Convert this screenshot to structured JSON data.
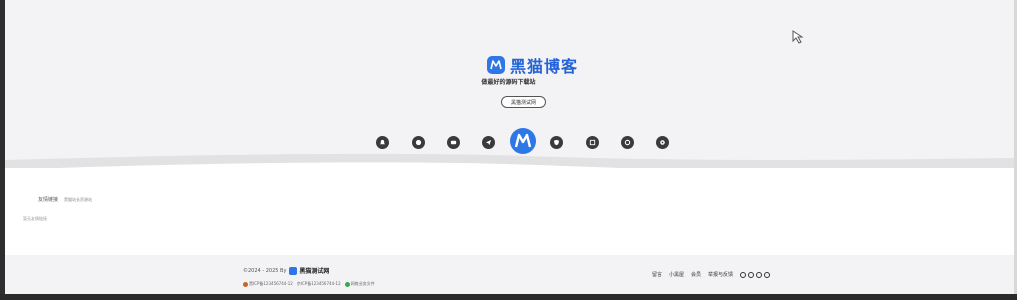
{
  "hero": {
    "logo_text": "黑猫博客",
    "slogan": "做最好的源码下载站",
    "pill_label": "黑猫测试网"
  },
  "icons": [
    "bell-icon",
    "chat-icon",
    "folder-icon",
    "send-icon",
    "brand-icon",
    "shield-icon",
    "image-icon",
    "message-icon",
    "settings-icon"
  ],
  "links": {
    "title": "友情链接",
    "item": "黑猫站长资源站",
    "empty_notice": "暂无友情链接"
  },
  "footer": {
    "copyright": "©2024 - 2025 By",
    "brand": "黑猫测试网",
    "icp1": "黑ICP备123456744-12",
    "icp2": "京ICP备123456744-12",
    "icp3": "网络业务文件",
    "nav": [
      "留言",
      "小黑屋",
      "会员",
      "举报与反馈"
    ]
  },
  "colors": {
    "brand_blue": "#2d77e6",
    "background": "#f3f3f5",
    "icon_dark": "#3a3a3a"
  }
}
